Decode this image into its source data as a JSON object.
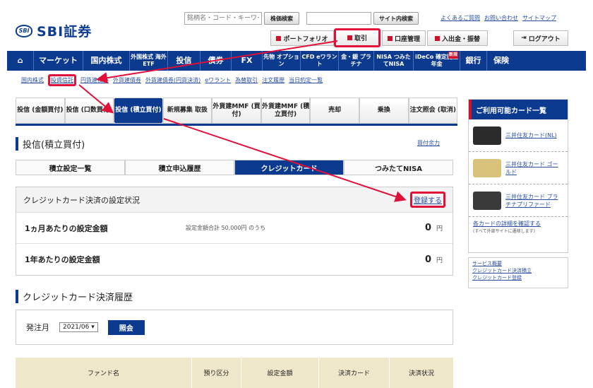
{
  "header": {
    "logo_mark": "SBI",
    "logo_text": "SBI証券",
    "search_placeholder": "銘柄名・コード・キーワード",
    "stock_search": "株価検索",
    "site_search": "サイト内検索",
    "links": [
      "よくあるご質問",
      "お問い合わせ",
      "サイトマップ"
    ],
    "buttons": {
      "portfolio": "ポートフォリオ",
      "trade": "取引",
      "account": "口座管理",
      "deposit": "入出金・振替",
      "logout": "ログアウト"
    }
  },
  "nav": [
    "マーケット",
    "国内株式",
    "外国株式 海外ETF",
    "投信",
    "債券",
    "FX",
    "先物 オプション",
    "CFD eワラント",
    "金・銀 プラチナ",
    "NISA つみたてNISA",
    "iDeCo 確定拠出年金",
    "銀行",
    "保険"
  ],
  "nav_badge": "新規",
  "subnav": [
    "国内株式",
    "投資信託",
    "円貨建債券",
    "外貨建債券",
    "外貨建債券(円貨決済)",
    "eワラント",
    "為替取引",
    "注文履歴",
    "当日約定一覧"
  ],
  "tabs": [
    "投信 (金額買付)",
    "投信 (口数買付)",
    "投信 (積立買付)",
    "新規募集 取扱",
    "外貨建MMF (買付)",
    "外貨建MMF (積立買付)",
    "売却",
    "乗換",
    "注文照会 (取消)"
  ],
  "page_title": "投信(積立買付)",
  "buying_power": "買付余力",
  "subtabs": [
    "積立設定一覧",
    "積立申込履歴",
    "クレジットカード",
    "つみたてNISA"
  ],
  "panel": {
    "title": "クレジットカード決済の設定状況",
    "register": "登録する",
    "rows": [
      {
        "label": "1ヵ月あたりの設定金額",
        "note": "設定金額合計 50,000円 のうち",
        "value": "0",
        "unit": "円"
      },
      {
        "label": "1年あたりの設定金額",
        "value": "0",
        "unit": "円"
      }
    ]
  },
  "history": {
    "title": "クレジットカード決済履歴",
    "month_label": "発注月",
    "month_value": "2021/06",
    "button": "照会",
    "columns": [
      "ファンド名",
      "預り区分",
      "設定金額",
      "決済カード",
      "決済状況"
    ]
  },
  "sidebar": {
    "title": "ご利用可能カード一覧",
    "cards": [
      {
        "name": "三井住友カード(NL)",
        "color": "#2b2b2b"
      },
      {
        "name": "三井住友カード ゴールド",
        "color": "#d9c27a"
      },
      {
        "name": "三井住友カード プラチナプリファード",
        "color": "#3a3a3a"
      }
    ],
    "detail_link": "各カードの詳細を確認する",
    "detail_note": "(すべて外部サイトに遷移します)",
    "services": [
      "サービス概要",
      "クレジットカード決済積立",
      "クレジットカード登録"
    ]
  }
}
